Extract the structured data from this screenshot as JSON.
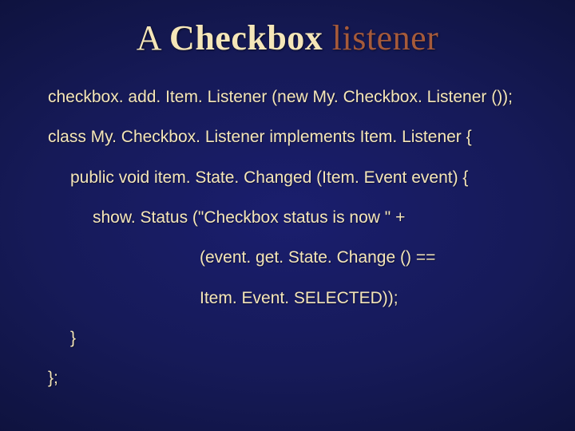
{
  "slide": {
    "title": {
      "word1": "A",
      "word2": "Checkbox",
      "word3": "listener"
    },
    "code": {
      "l1": "checkbox. add. Item. Listener (new My. Checkbox. Listener ());",
      "l2": "class My. Checkbox. Listener implements Item. Listener {",
      "l3": "public void item. State. Changed (Item. Event event) {",
      "l4": "show. Status (\"Checkbox status is now \" +",
      "l5": "(event. get. State. Change () ==",
      "l6": "Item. Event. SELECTED));",
      "l7": "}",
      "l8": "};"
    }
  }
}
